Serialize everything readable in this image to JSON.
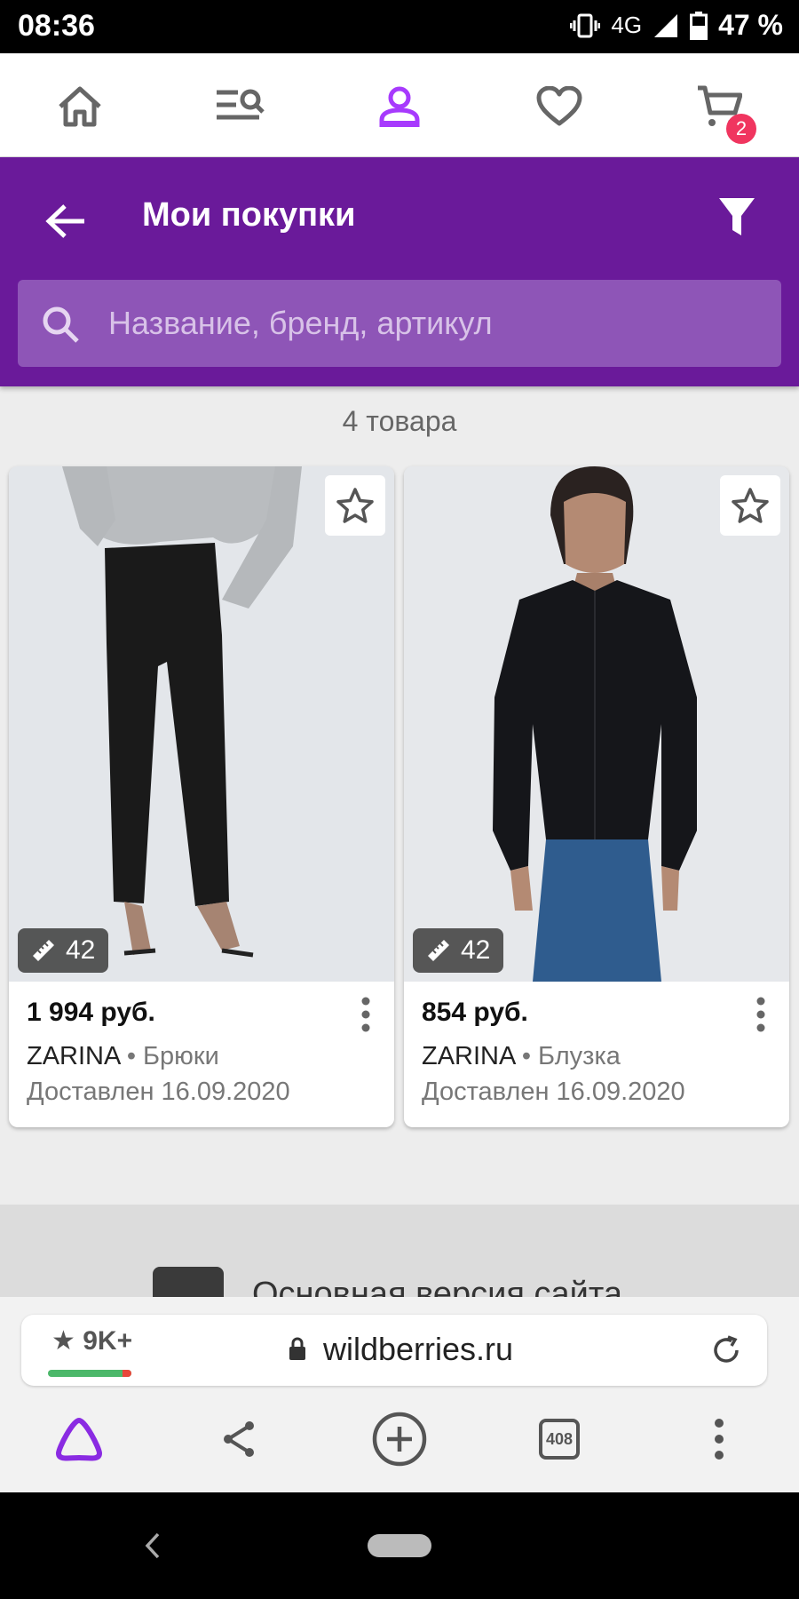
{
  "status_bar": {
    "time": "08:36",
    "network": "4G",
    "battery": "47 %"
  },
  "top_nav": {
    "items": [
      {
        "icon": "home-icon"
      },
      {
        "icon": "catalog-search-icon"
      },
      {
        "icon": "profile-icon",
        "active_color": "#a73afd"
      },
      {
        "icon": "heart-icon"
      },
      {
        "icon": "cart-icon"
      }
    ],
    "cart_badge": "2"
  },
  "header": {
    "title": "Мои покупки",
    "search_placeholder": "Название, бренд, артикул",
    "bg_color": "#6a1a9a"
  },
  "items_count": "4 товара",
  "products": [
    {
      "size": "42",
      "price": "1 994 руб.",
      "brand": "ZARINA",
      "category": "• Брюки",
      "delivered": "Доставлен 16.09.2020"
    },
    {
      "size": "42",
      "price": "854 руб.",
      "brand": "ZARINA",
      "category": "• Блузка",
      "delivered": "Доставлен 16.09.2020"
    }
  ],
  "promo": {
    "label": "Основная версия сайта"
  },
  "browser": {
    "rating": "9K+",
    "url": "wildberries.ru",
    "tabs_count": "408"
  }
}
